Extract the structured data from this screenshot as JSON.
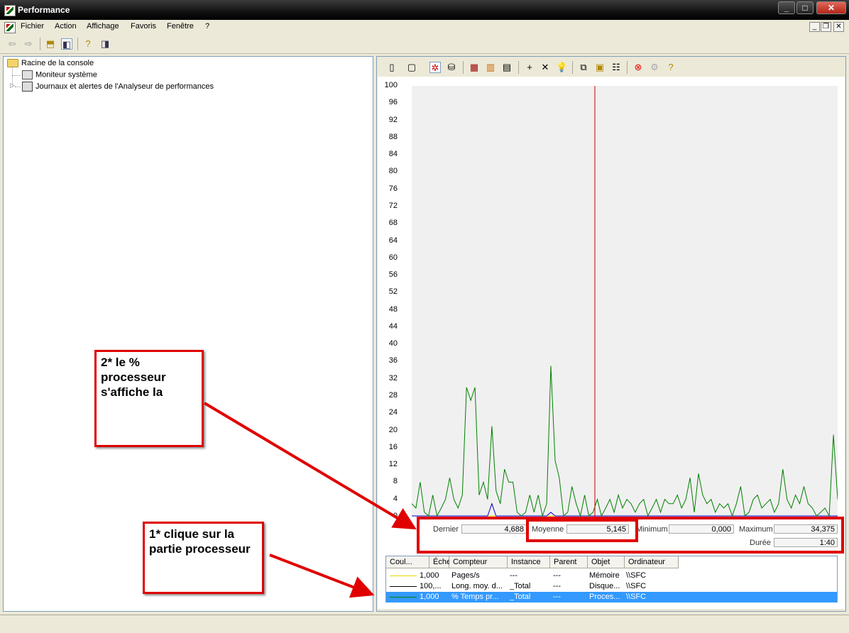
{
  "window": {
    "title": "Performance"
  },
  "menu": [
    "Fichier",
    "Action",
    "Affichage",
    "Favoris",
    "Fenêtre",
    "?"
  ],
  "tree": {
    "root": "Racine de la console",
    "children": [
      "Moniteur système",
      "Journaux et alertes de l'Analyseur de performances"
    ]
  },
  "chart_data": {
    "type": "line",
    "y_ticks": [
      "100",
      "96",
      "92",
      "88",
      "84",
      "80",
      "76",
      "72",
      "68",
      "64",
      "60",
      "56",
      "52",
      "48",
      "44",
      "40",
      "36",
      "32",
      "28",
      "24",
      "20",
      "16",
      "12",
      "8",
      "4",
      "0"
    ],
    "ylim": [
      0,
      100
    ],
    "grid": false,
    "series": [
      {
        "color": "#008000",
        "values": [
          3,
          2,
          8,
          1,
          0,
          5,
          0,
          2,
          4,
          9,
          4,
          2,
          5,
          30,
          27,
          30,
          5,
          8,
          4,
          21,
          6,
          3,
          11,
          8,
          8,
          1,
          0,
          1,
          5,
          1,
          5,
          0,
          3,
          35,
          13,
          9,
          0,
          1,
          7,
          3,
          0,
          5,
          0,
          1,
          4,
          0,
          2,
          4,
          1,
          5,
          2,
          4,
          3,
          1,
          3,
          4,
          0,
          2,
          4,
          1,
          4,
          3,
          3,
          5,
          2,
          4,
          9,
          1,
          10,
          5,
          3,
          4,
          1,
          3,
          2,
          3,
          0,
          3,
          7,
          0,
          1,
          4,
          5,
          2,
          3,
          4,
          1,
          3,
          11,
          4,
          2,
          5,
          3,
          7,
          3,
          2,
          0,
          1,
          2,
          0,
          19,
          4
        ]
      },
      {
        "color": "#0000cc",
        "values": [
          0,
          0,
          0,
          0,
          0,
          0,
          0,
          0,
          0,
          0,
          0,
          0,
          0,
          0,
          0,
          0,
          0,
          0,
          0,
          3,
          0,
          0,
          0,
          0,
          0,
          0,
          0,
          0,
          0,
          0,
          0,
          0,
          0,
          1,
          0,
          0,
          0,
          0,
          0,
          0,
          0,
          0,
          0,
          0,
          0,
          0,
          0,
          0,
          0,
          0,
          0,
          0,
          0,
          0,
          0,
          0,
          0,
          0,
          0,
          0,
          0,
          0,
          0,
          0,
          0,
          0,
          0,
          0,
          0,
          0,
          0,
          0,
          0,
          0,
          0,
          0,
          0,
          0,
          0,
          0,
          0,
          0,
          0,
          0,
          0,
          0,
          0,
          0,
          0,
          0,
          0,
          0,
          0,
          0,
          0,
          0,
          0,
          0,
          0,
          0,
          0,
          0
        ]
      },
      {
        "color": "#e6d800",
        "values": [
          0,
          0,
          0,
          0,
          0,
          0,
          0,
          0,
          0,
          0,
          0,
          0,
          0,
          0,
          0,
          0,
          0,
          0,
          0,
          0,
          0,
          0,
          0,
          0,
          0,
          0,
          0,
          0,
          0,
          0,
          0,
          0,
          0,
          0,
          0,
          0,
          0,
          0,
          0,
          0,
          0,
          0,
          0,
          0,
          0,
          0,
          0,
          0,
          0,
          0,
          0,
          0,
          0,
          0,
          0,
          0,
          0,
          0,
          0,
          0,
          0,
          0,
          0,
          0,
          0,
          0,
          0,
          0,
          0,
          0,
          0,
          0,
          0,
          0,
          0,
          0,
          0,
          0,
          0,
          0,
          0,
          0,
          0,
          0,
          0,
          0,
          0,
          0,
          0,
          0,
          0,
          0,
          0,
          0,
          0,
          0,
          0,
          0,
          0,
          0,
          0,
          0
        ]
      }
    ],
    "cursor_color": "#cc0000",
    "cursor_fraction": 0.43
  },
  "stats": {
    "dernier_label": "Dernier",
    "dernier_value": "4,688",
    "moyenne_label": "Moyenne",
    "moyenne_value": "5,145",
    "minimum_label": "Minimum",
    "minimum_value": "0,000",
    "maximum_label": "Maximum",
    "maximum_value": "34,375",
    "duree_label": "Durée",
    "duree_value": "1:40"
  },
  "legend": {
    "headers": [
      "Coul...",
      "Échelle",
      "Compteur",
      "Instance",
      "Parent",
      "Objet",
      "Ordinateur"
    ],
    "rows": [
      {
        "color": "#e6d800",
        "echelle": "1,000",
        "compteur": "Pages/s",
        "instance": "---",
        "parent": "---",
        "objet": "Mémoire",
        "ordinateur": "\\\\SFC"
      },
      {
        "color": "#000000",
        "echelle": "100,...",
        "compteur": "Long. moy. d...",
        "instance": "_Total",
        "parent": "---",
        "objet": "Disque...",
        "ordinateur": "\\\\SFC"
      },
      {
        "color": "#008000",
        "echelle": "1,000",
        "compteur": "% Temps pr...",
        "instance": "_Total",
        "parent": "---",
        "objet": "Proces...",
        "ordinateur": "\\\\SFC"
      }
    ]
  },
  "annotations": {
    "note2": "2* le % processeur s'affiche la",
    "note1": "1* clique sur la partie processeur",
    "color": "#e00000"
  }
}
